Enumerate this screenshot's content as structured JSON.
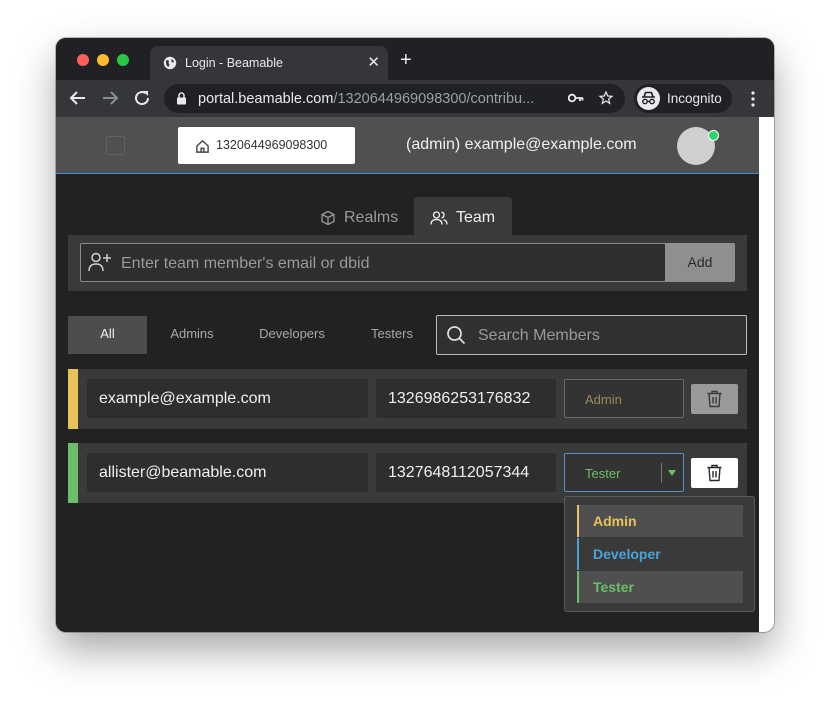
{
  "browser": {
    "tab_title": "Login - Beamable",
    "new_tab_symbol": "+",
    "close_symbol": "✕",
    "url_host": "portal.beamable.com",
    "url_path": "/1320644969098300/contribu...",
    "incognito_label": "Incognito"
  },
  "header": {
    "realm_id": "1320644969098300",
    "user_label": "(admin) example@example.com"
  },
  "page_tabs": [
    {
      "label": "Realms",
      "icon": "cube-icon"
    },
    {
      "label": "Team",
      "icon": "users-icon"
    }
  ],
  "add_member": {
    "placeholder": "Enter team member's email or dbid",
    "button_label": "Add"
  },
  "filters": [
    {
      "label": "All",
      "active": true
    },
    {
      "label": "Admins",
      "active": false
    },
    {
      "label": "Developers",
      "active": false
    },
    {
      "label": "Testers",
      "active": false
    }
  ],
  "search": {
    "placeholder": "Search Members"
  },
  "members": [
    {
      "email": "example@example.com",
      "dbid": "1326986253176832",
      "role": "Admin",
      "role_color": "#e8c35a",
      "disabled": true
    },
    {
      "email": "allister@beamable.com",
      "dbid": "1327648112057344",
      "role": "Tester",
      "role_color": "#6bbf6b",
      "disabled": false
    }
  ],
  "role_options": [
    {
      "label": "Admin",
      "color": "#e8c35a"
    },
    {
      "label": "Developer",
      "color": "#4aa3d8"
    },
    {
      "label": "Tester",
      "color": "#6bbf6b"
    }
  ],
  "colors": {
    "admin": "#e8c35a",
    "developer": "#4aa3d8",
    "tester": "#6bbf6b",
    "online": "#2ed36a"
  }
}
